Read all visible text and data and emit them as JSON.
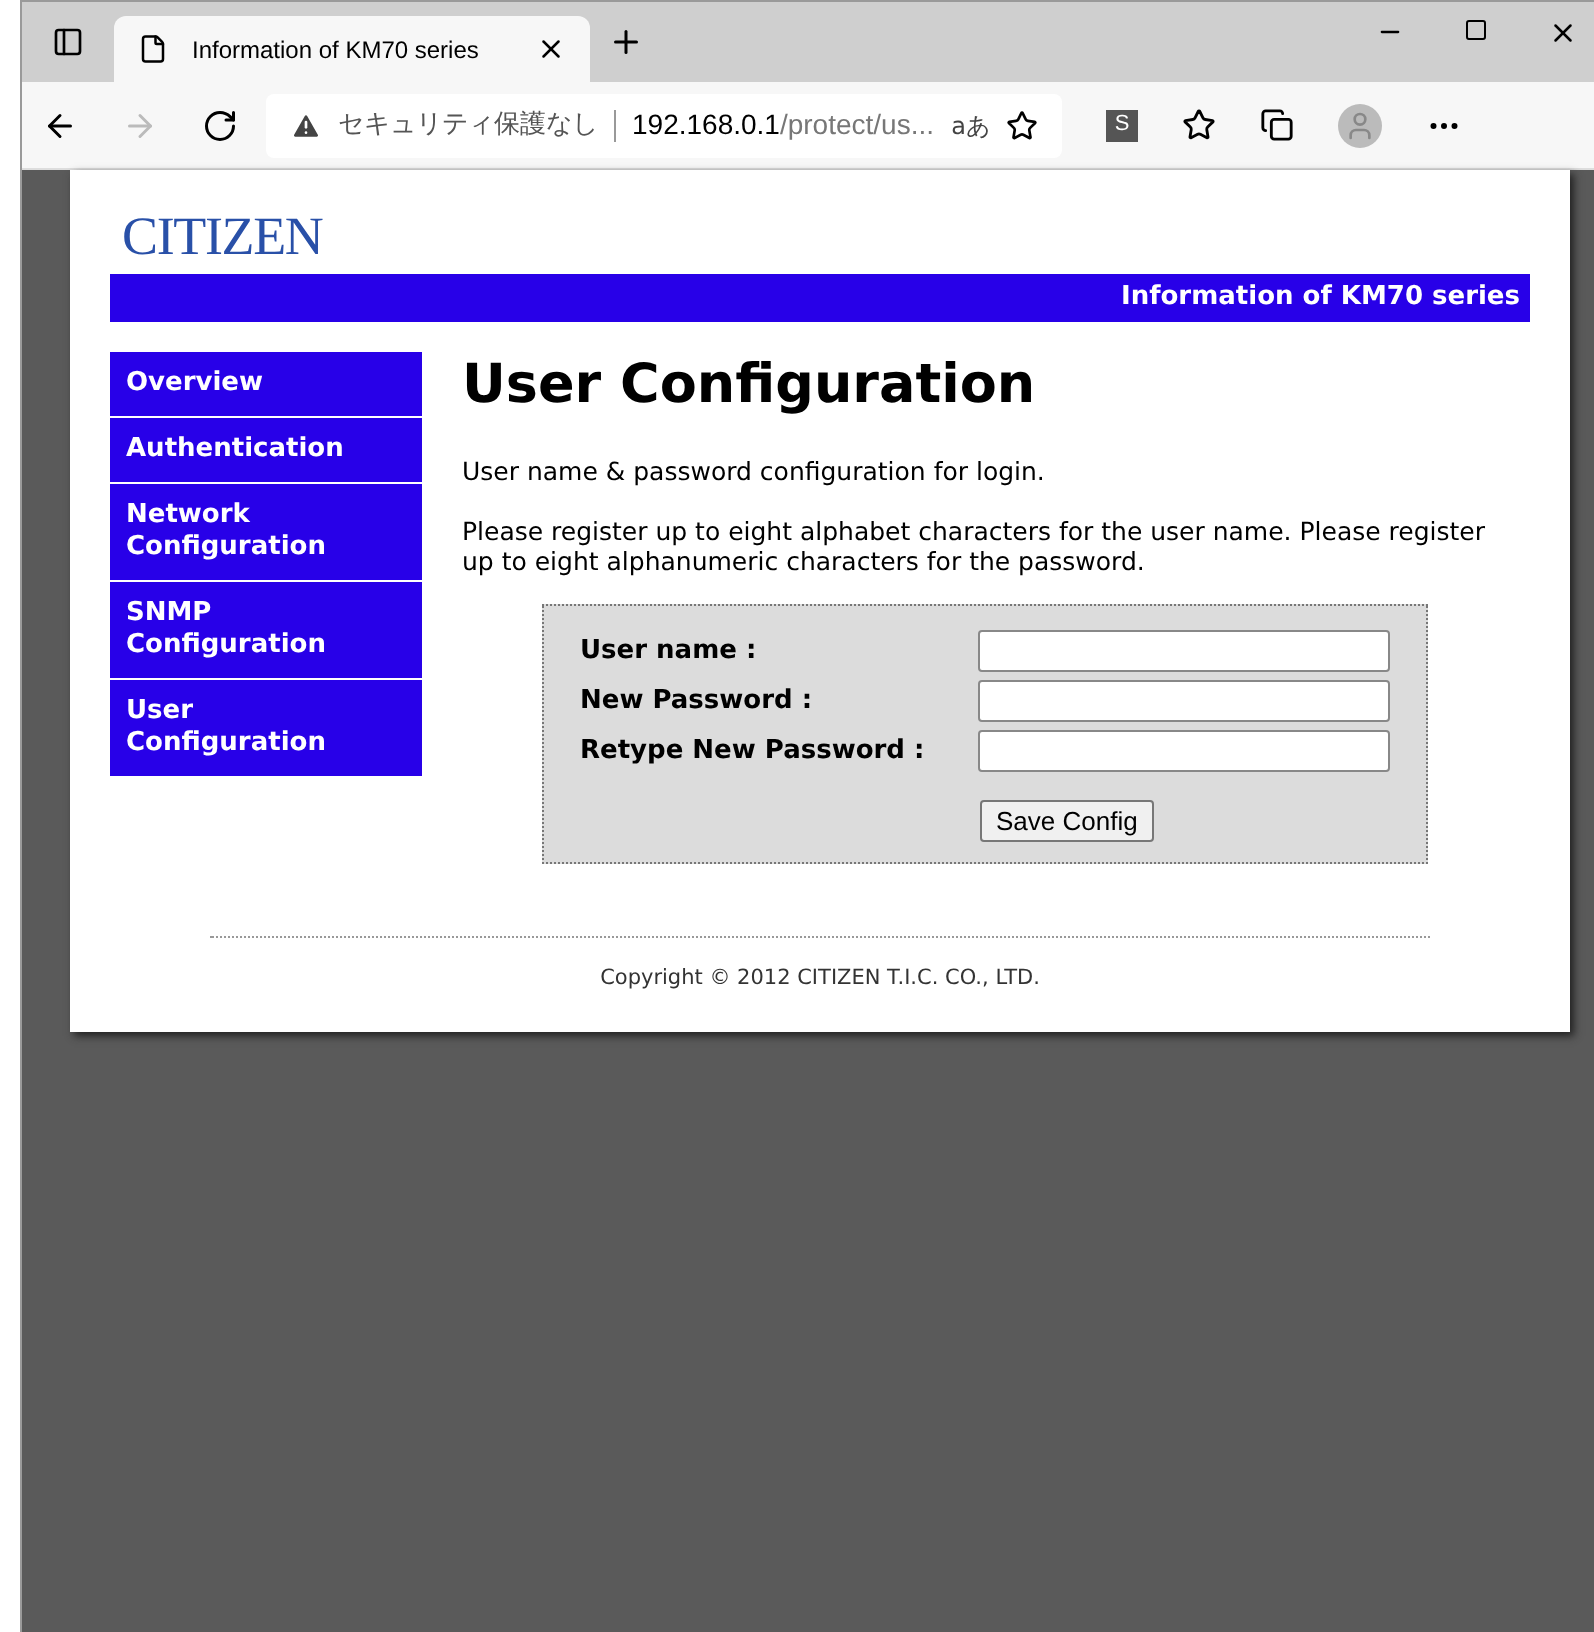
{
  "browser": {
    "tab_title": "Information of KM70 series",
    "security_label": "セキュリティ保護なし",
    "url_host": "192.168.0.1",
    "url_path": "/protect/us...",
    "read_aloud": "aあ",
    "profile_letter": "S"
  },
  "header": {
    "logo": "CITIZEN",
    "banner": "Information of KM70 series"
  },
  "sidebar": {
    "items": [
      {
        "label": "Overview"
      },
      {
        "label": "Authentication"
      },
      {
        "label": "Network Configuration"
      },
      {
        "label": "SNMP Configuration"
      },
      {
        "label": "User Configuration"
      }
    ]
  },
  "content": {
    "title": "User Configuration",
    "intro": "User name & password configuration for login.",
    "instructions": "Please register up to eight alphabet characters for the user name. Please register up to eight alphanumeric characters for the password.",
    "form": {
      "fields": [
        {
          "label": "User name :"
        },
        {
          "label": "New Password :"
        },
        {
          "label": "Retype New Password :"
        }
      ],
      "button": "Save Config"
    }
  },
  "footer": {
    "copyright": "Copyright © 2012 CITIZEN T.I.C. CO., LTD."
  }
}
